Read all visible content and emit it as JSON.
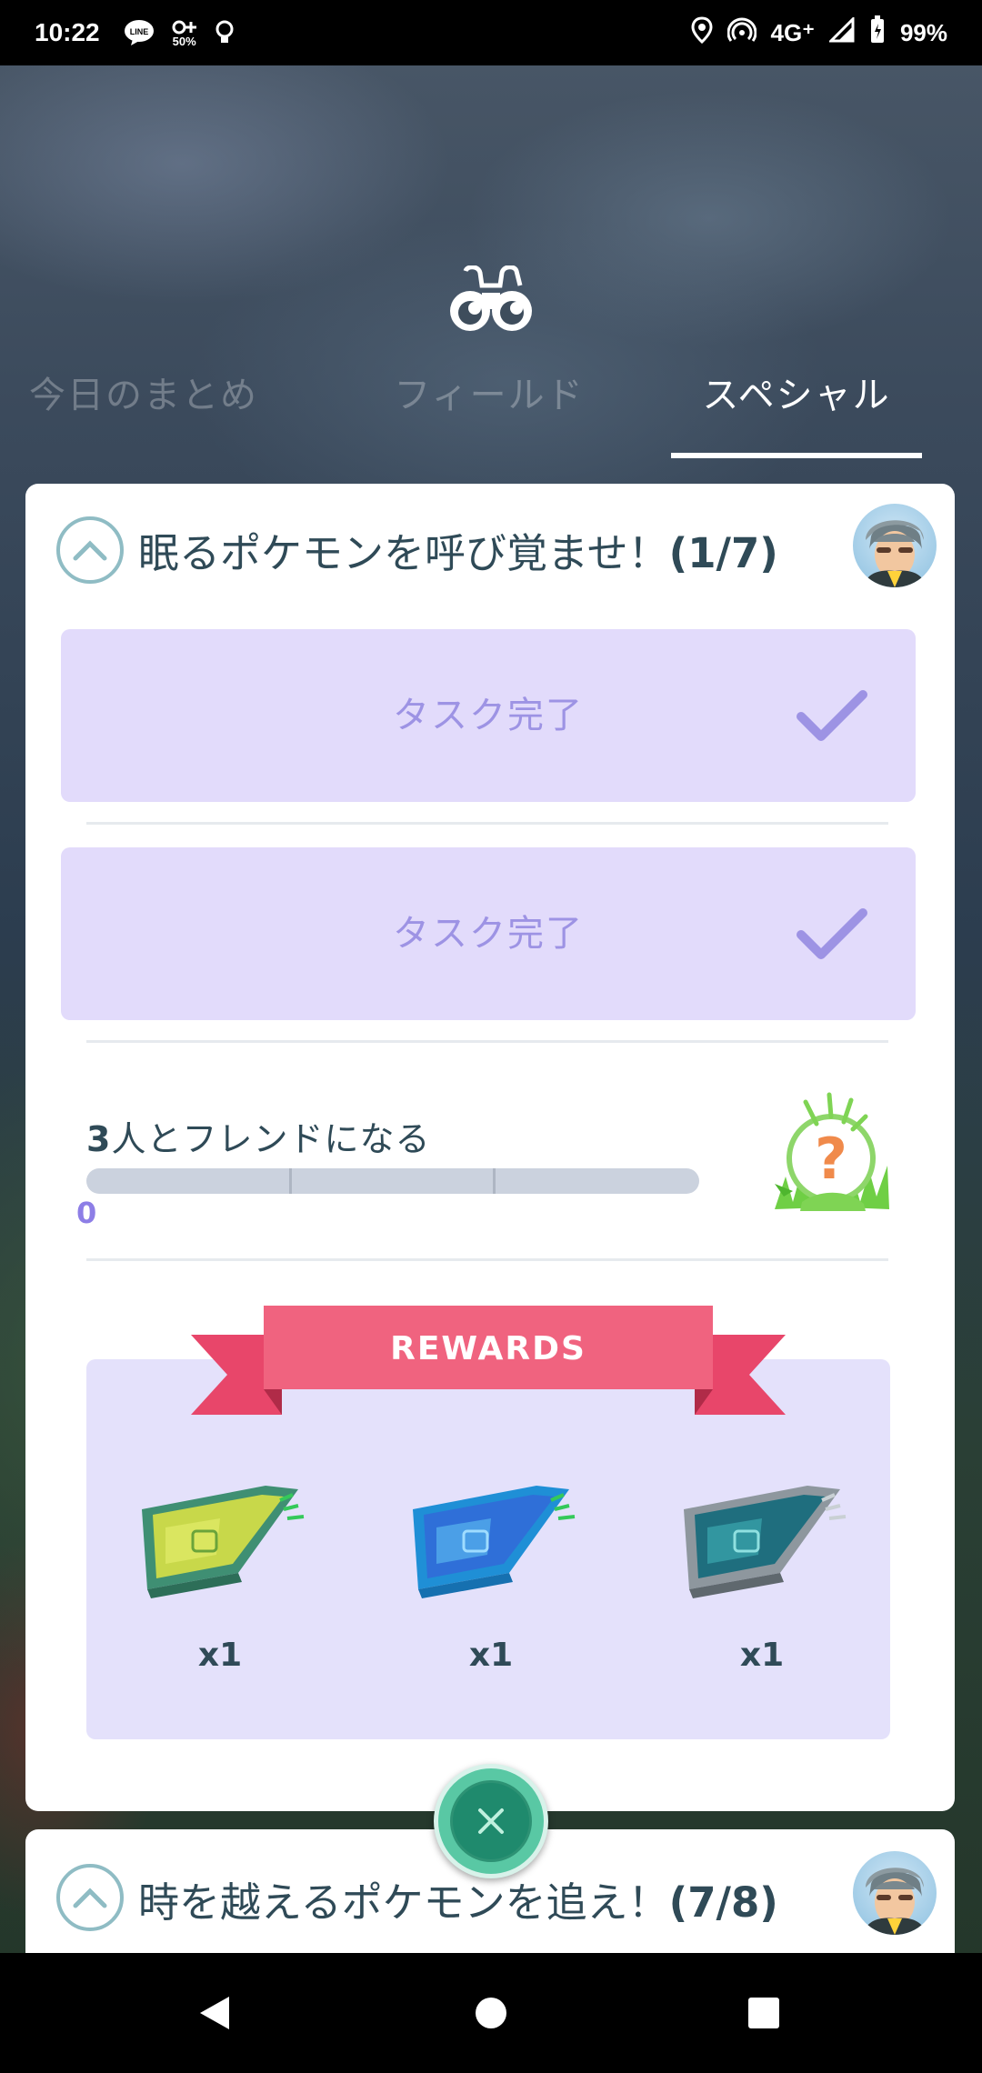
{
  "status_bar": {
    "time": "10:22",
    "network": "4G⁺",
    "battery": "99%",
    "data_saver": "50%"
  },
  "header": {
    "icon": "binoculars-icon",
    "tabs": [
      {
        "label": "今日のまとめ",
        "active": false
      },
      {
        "label": "フィールド",
        "active": false
      },
      {
        "label": "スペシャル",
        "active": true
      }
    ]
  },
  "research_1": {
    "title": "眠るポケモンを呼び覚ませ！",
    "count": "(1/7)",
    "tasks": [
      {
        "label": "タスク完了",
        "completed": true
      },
      {
        "label": "タスク完了",
        "completed": true
      }
    ],
    "current_task": {
      "count_prefix": "3",
      "label": "人とフレンドになる",
      "progress_value": "0",
      "progress_fraction": 0,
      "reward_icon": "mystery-encounter-icon"
    },
    "rewards_label": "REWARDS",
    "rewards": [
      {
        "name": "green-lure-module-icon",
        "qty": "x1"
      },
      {
        "name": "blue-lure-module-icon",
        "qty": "x1"
      },
      {
        "name": "silver-lure-module-icon",
        "qty": "x1"
      }
    ]
  },
  "research_2": {
    "title": "時を越えるポケモンを追え！",
    "count": "(7/8)"
  },
  "colors": {
    "accent_purple": "#8d7ee6",
    "task_done_bg": "#e2dbfb",
    "ribbon": "#f0637f",
    "close_button": "#59c8a4"
  }
}
